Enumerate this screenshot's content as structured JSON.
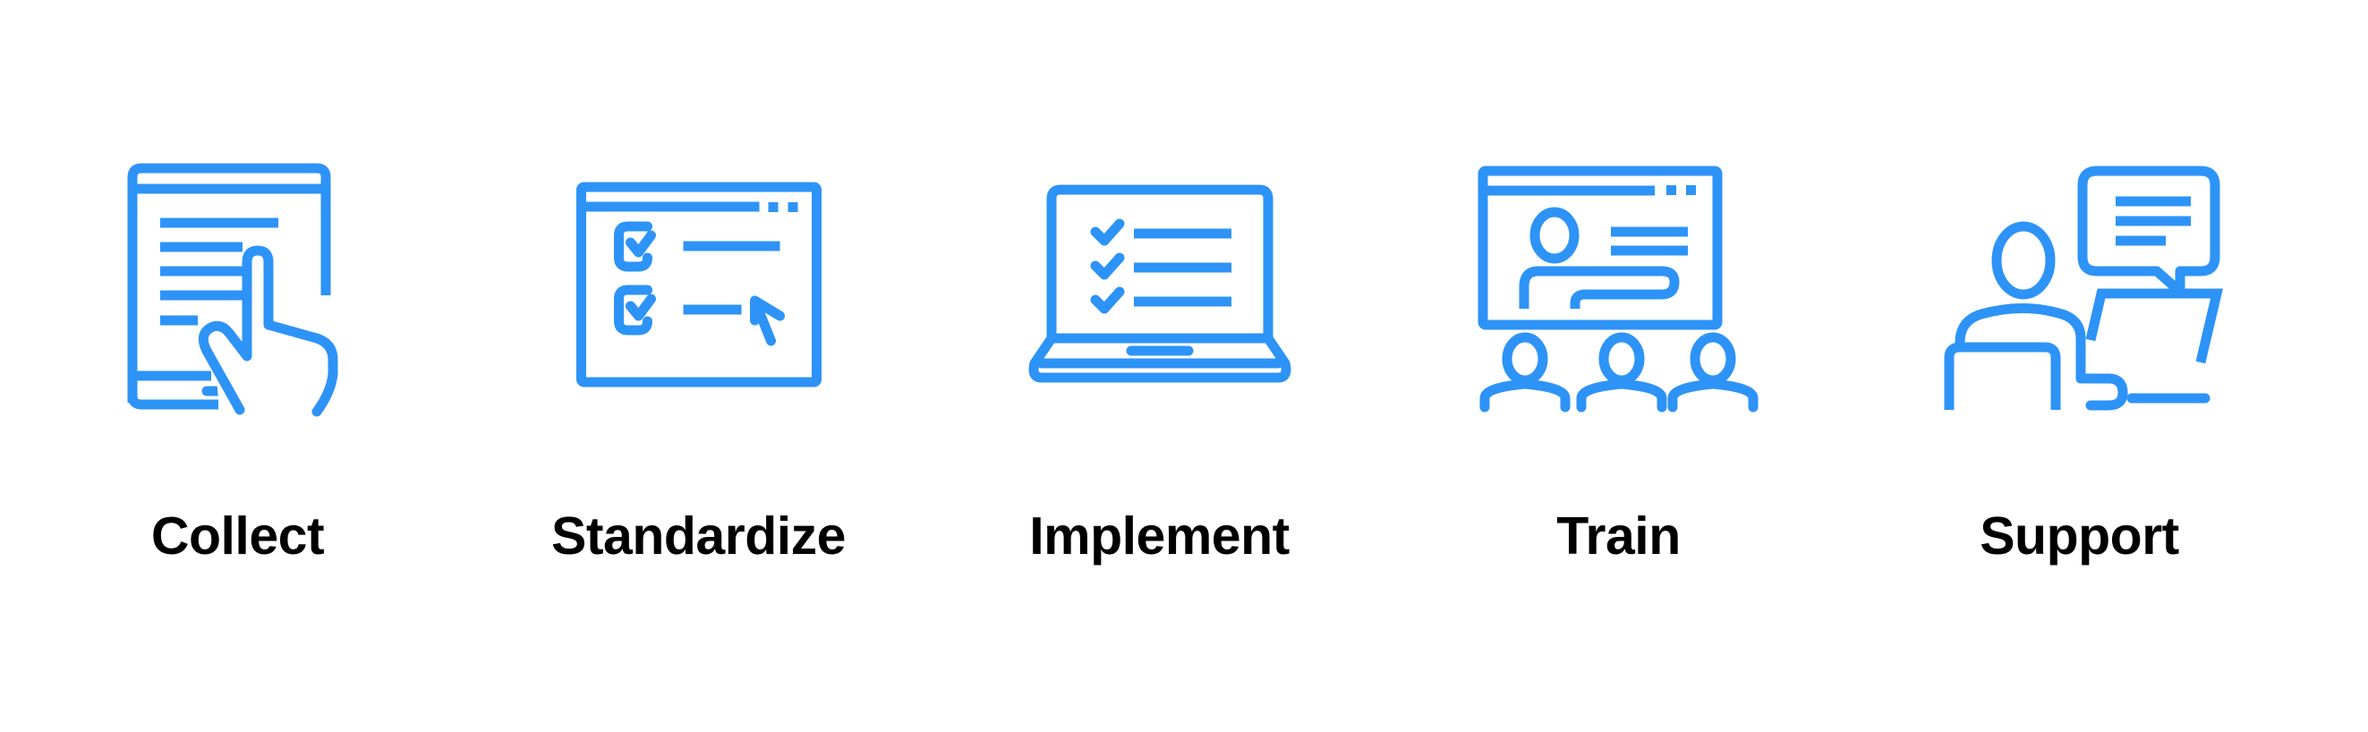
{
  "theme": {
    "icon_color": "#2D93F7",
    "text_color": "#000000",
    "background": "#FFFFFF"
  },
  "steps": [
    {
      "label": "Collect",
      "icon": "tablet-touch-icon"
    },
    {
      "label": "Standardize",
      "icon": "checklist-window-icon"
    },
    {
      "label": "Implement",
      "icon": "laptop-checklist-icon"
    },
    {
      "label": "Train",
      "icon": "presentation-audience-icon"
    },
    {
      "label": "Support",
      "icon": "support-agent-chat-icon"
    }
  ]
}
